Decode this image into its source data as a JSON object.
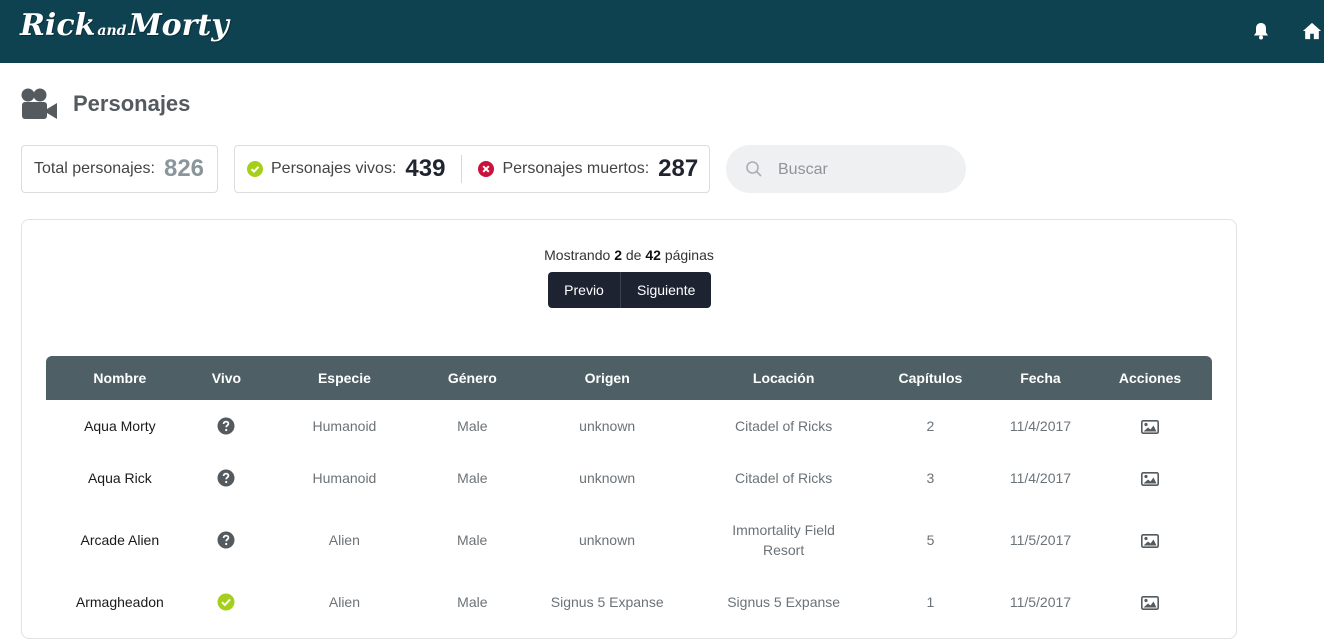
{
  "brand": {
    "logo_main": "Rick",
    "logo_small": "and",
    "logo_end": "Morty"
  },
  "nav": {
    "icons": [
      "bell-icon",
      "home-icon"
    ]
  },
  "page": {
    "title": "Personajes"
  },
  "stats": {
    "total_label": "Total personajes:",
    "total_value": "826",
    "alive_label": "Personajes vivos:",
    "alive_value": "439",
    "dead_label": "Personajes muertos:",
    "dead_value": "287"
  },
  "search": {
    "placeholder": "Buscar"
  },
  "pager": {
    "prefix": "Mostrando",
    "current": "2",
    "middle": "de",
    "total": "42",
    "suffix": "páginas",
    "prev_label": "Previo",
    "next_label": "Siguiente"
  },
  "table": {
    "headers": [
      "Nombre",
      "Vivo",
      "Especie",
      "Género",
      "Origen",
      "Locación",
      "Capítulos",
      "Fecha",
      "Acciones"
    ],
    "rows": [
      {
        "name": "Aqua Morty",
        "status": "unknown",
        "species": "Humanoid",
        "gender": "Male",
        "origin": "unknown",
        "location": "Citadel of Ricks",
        "episodes": "2",
        "date": "11/4/2017"
      },
      {
        "name": "Aqua Rick",
        "status": "unknown",
        "species": "Humanoid",
        "gender": "Male",
        "origin": "unknown",
        "location": "Citadel of Ricks",
        "episodes": "3",
        "date": "11/4/2017"
      },
      {
        "name": "Arcade Alien",
        "status": "unknown",
        "species": "Alien",
        "gender": "Male",
        "origin": "unknown",
        "location": "Immortality Field Resort",
        "episodes": "5",
        "date": "11/5/2017"
      },
      {
        "name": "Armagheadon",
        "status": "alive",
        "species": "Alien",
        "gender": "Male",
        "origin": "Signus 5 Expanse",
        "location": "Signus 5 Expanse",
        "episodes": "1",
        "date": "11/5/2017"
      }
    ]
  },
  "colors": {
    "navbar": "#0f4250",
    "table_header": "#4f5f66",
    "alive": "#a6cf1b",
    "dead": "#c8143c",
    "button": "#1d2331"
  }
}
